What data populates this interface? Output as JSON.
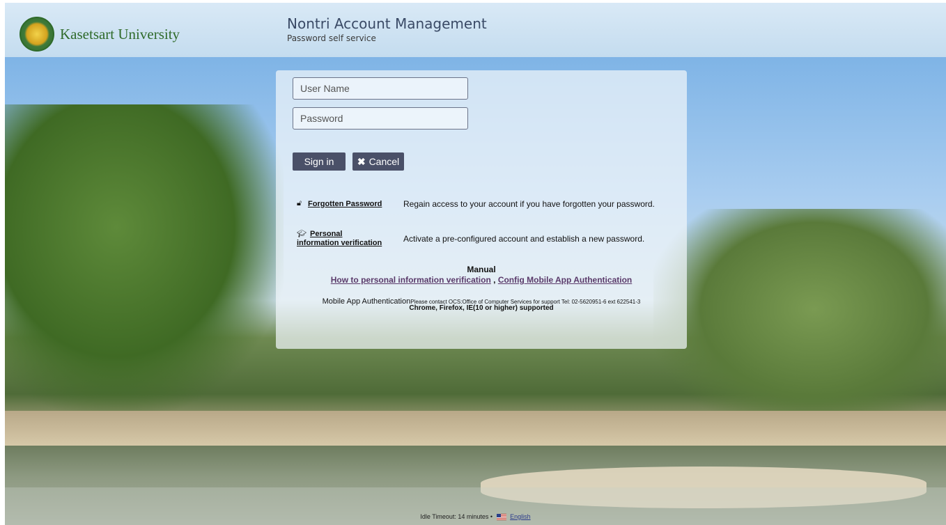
{
  "header": {
    "university": "Kasetsart University",
    "title": "Nontri Account Management",
    "subtitle": "Password self service"
  },
  "login": {
    "username_placeholder": "User Name",
    "password_placeholder": "Password",
    "signin_label": "Sign in",
    "cancel_label": "Cancel"
  },
  "options": [
    {
      "link": "Forgotten Password",
      "description": "Regain access to your account if you have forgotten your password.",
      "icon": "unlock-icon"
    },
    {
      "link_line1": "Personal",
      "link_line2": "information verification",
      "description": "Activate a pre-configured account and establish a new password.",
      "icon": "graduation-cap-icon"
    }
  ],
  "manual": {
    "heading": "Manual",
    "link1": "How to personal information verification",
    "separator": ",",
    "link2": "Config Mobile App Authentication"
  },
  "support": {
    "label": "Mobile App Authentication",
    "contact": "Please contact OCS:Office of Computer Services for support Tel: 02-5620951-6 ext 622541-3",
    "browsers": "Chrome, Firefox, IE(10 or higher) supported"
  },
  "footer": {
    "idle_timeout": "Idle Timeout: 14 minutes",
    "separator": "•",
    "language": "English"
  }
}
